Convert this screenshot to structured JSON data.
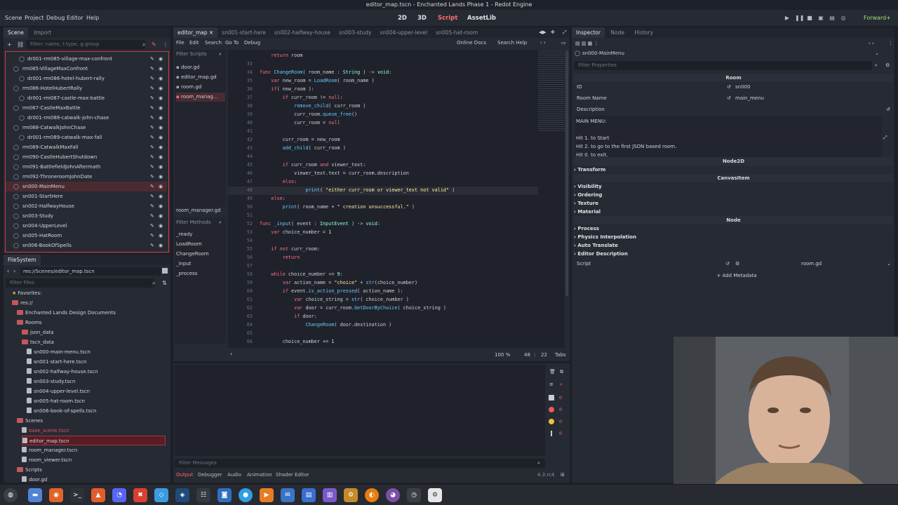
{
  "window_title": "editor_map.tscn - Enchanted Lands Phase 1 - Redot Engine",
  "menu": [
    "Scene",
    "Project",
    "Debug",
    "Editor",
    "Help"
  ],
  "workspaces": [
    "2D",
    "3D",
    "Script",
    "AssetLib"
  ],
  "renderer": "Forward+",
  "scene_dock": {
    "tabs": [
      "Scene",
      "Import"
    ],
    "filter_placeholder": "Filter: name, t:type, g:group",
    "items": [
      {
        "label": "dr001-rm085-village-max-confront",
        "indent": 1
      },
      {
        "label": "rm085-VillageMaxConfront",
        "indent": 0
      },
      {
        "label": "dr001-rm086-hotel-hubert-rally",
        "indent": 1
      },
      {
        "label": "rm086-HotelHubertRally",
        "indent": 0
      },
      {
        "label": "dr001-rm087-castle-max-battle",
        "indent": 1
      },
      {
        "label": "rm087-CastleMaxBattle",
        "indent": 0
      },
      {
        "label": "dr001-rm088-catwalk-john-chase",
        "indent": 1
      },
      {
        "label": "rm088-CatwalkJohnChase",
        "indent": 0
      },
      {
        "label": "dr001-rm089-catwalk-max-fall",
        "indent": 1
      },
      {
        "label": "rm089-CatwalkMaxFall",
        "indent": 0
      },
      {
        "label": "rm090-CastleHubertShutdown",
        "indent": 0
      },
      {
        "label": "rm091-BattlefieldJohnAftermath",
        "indent": 0
      },
      {
        "label": "rm092-ThroneroomJohnDate",
        "indent": 0
      },
      {
        "label": "sn000-MainMenu",
        "indent": 0,
        "selected": true
      },
      {
        "label": "sn001-StartHere",
        "indent": 0
      },
      {
        "label": "sn002-HalfwayHouse",
        "indent": 0
      },
      {
        "label": "sn003-Study",
        "indent": 0
      },
      {
        "label": "sn004-UpperLevel",
        "indent": 0
      },
      {
        "label": "sn005-HatRoom",
        "indent": 0
      },
      {
        "label": "sn006-BookOfSpells",
        "indent": 0
      }
    ]
  },
  "filesystem": {
    "title": "FileSystem",
    "path": "res://Scenes/editor_map.tscn",
    "filter_placeholder": "Filter Files",
    "items": [
      {
        "label": "Favorites:",
        "indent": 1,
        "type": "fav"
      },
      {
        "label": "res://",
        "indent": 1,
        "type": "folder"
      },
      {
        "label": "Enchanted Lands Design Documents",
        "indent": 2,
        "type": "folder"
      },
      {
        "label": "Rooms",
        "indent": 2,
        "type": "folder"
      },
      {
        "label": "json_data",
        "indent": 3,
        "type": "folder"
      },
      {
        "label": "tscn_data",
        "indent": 3,
        "type": "folder"
      },
      {
        "label": "sn000-main-menu.tscn",
        "indent": 4,
        "type": "file"
      },
      {
        "label": "sn001-start-here.tscn",
        "indent": 4,
        "type": "file"
      },
      {
        "label": "sn002-halfway-house.tscn",
        "indent": 4,
        "type": "file"
      },
      {
        "label": "sn003-study.tscn",
        "indent": 4,
        "type": "file"
      },
      {
        "label": "sn004-upper-level.tscn",
        "indent": 4,
        "type": "file"
      },
      {
        "label": "sn005-hat-room.tscn",
        "indent": 4,
        "type": "file"
      },
      {
        "label": "sn006-book-of-spells.tscn",
        "indent": 4,
        "type": "file"
      },
      {
        "label": "Scenes",
        "indent": 2,
        "type": "folder"
      },
      {
        "label": "base_scene.tscn",
        "indent": 3,
        "type": "file",
        "red": true
      },
      {
        "label": "editor_map.tscn",
        "indent": 3,
        "type": "file",
        "selected": true
      },
      {
        "label": "room_manager.tscn",
        "indent": 3,
        "type": "file"
      },
      {
        "label": "room_viewer.tscn",
        "indent": 3,
        "type": "file"
      },
      {
        "label": "Scripts",
        "indent": 2,
        "type": "folder"
      },
      {
        "label": "door.gd",
        "indent": 3,
        "type": "file"
      }
    ]
  },
  "script_tabs": [
    "editor_map",
    "sn001-start-here",
    "sn002-halfway-house",
    "sn003-study",
    "sn004-upper-level",
    "sn005-hat-room"
  ],
  "script_menu": [
    "File",
    "Edit",
    "Search",
    "Go To",
    "Debug"
  ],
  "online_docs": "Online Docs",
  "search_help": "Search Help",
  "filter_scripts": "Filter Scripts",
  "scripts": [
    "door.gd",
    "editor_map.gd",
    "room.gd",
    "room_manag..."
  ],
  "current_script": "room_manager.gd",
  "filter_methods": "Filter Methods",
  "methods": [
    "_ready",
    "LoadRoom",
    "ChangeRoom",
    "_input",
    "_process"
  ],
  "code": [
    {
      "n": "",
      "t": "    return room"
    },
    {
      "n": "33",
      "t": ""
    },
    {
      "n": "34",
      "t": "func ChangeRoom( room_name : String ) -> void:"
    },
    {
      "n": "35",
      "t": "    var new_room = LoadRoom( room_name )"
    },
    {
      "n": "36",
      "t": "    if( new_room ):"
    },
    {
      "n": "37",
      "t": "        if curr_room != null:"
    },
    {
      "n": "38",
      "t": "            remove_child( curr_room )"
    },
    {
      "n": "39",
      "t": "            curr_room.queue_free()"
    },
    {
      "n": "40",
      "t": "            curr_room = null"
    },
    {
      "n": "41",
      "t": ""
    },
    {
      "n": "42",
      "t": "        curr_room = new_room"
    },
    {
      "n": "43",
      "t": "        add_child( curr_room )"
    },
    {
      "n": "44",
      "t": ""
    },
    {
      "n": "45",
      "t": "        if curr_room and viewer_text:"
    },
    {
      "n": "46",
      "t": "            viewer_text.text = curr_room.description"
    },
    {
      "n": "47",
      "t": "        else:"
    },
    {
      "n": "48",
      "t": "                print( \"either curr_room or viewer_text not valid\" )"
    },
    {
      "n": "49",
      "t": "    else:"
    },
    {
      "n": "50",
      "t": "        print( room_name + \" creation unsuccessful.\" )"
    },
    {
      "n": "51",
      "t": ""
    },
    {
      "n": "52",
      "t": "func _input( event : InputEvent ) -> void:"
    },
    {
      "n": "53",
      "t": "    var choice_number = 1"
    },
    {
      "n": "54",
      "t": ""
    },
    {
      "n": "55",
      "t": "    if not curr_room:"
    },
    {
      "n": "56",
      "t": "        return"
    },
    {
      "n": "57",
      "t": ""
    },
    {
      "n": "58",
      "t": "    while choice_number <= 9:"
    },
    {
      "n": "59",
      "t": "        var action_name = \"choice\" + str(choice_number)"
    },
    {
      "n": "60",
      "t": "        if event.is_action_pressed( action_name ):"
    },
    {
      "n": "61",
      "t": "            var choice_string = str( choice_number )"
    },
    {
      "n": "62",
      "t": "            var door = curr_room.GetDoorByChoice( choice_string )"
    },
    {
      "n": "63",
      "t": "            if door:"
    },
    {
      "n": "64",
      "t": "                ChangeRoom( door.destination )"
    },
    {
      "n": "65",
      "t": ""
    },
    {
      "n": "66",
      "t": "        choice_number += 1"
    }
  ],
  "status": {
    "zoom": "100 %",
    "line": "48",
    "col": "22",
    "indent": "Tabs"
  },
  "filter_messages": "Filter Messages",
  "bottom_tabs": [
    "Output",
    "Debugger",
    "Audio",
    "Animation",
    "Shader Editor"
  ],
  "version": "4.3.rc4",
  "debug_counts": [
    "0",
    "0",
    "0",
    "0"
  ],
  "inspector": {
    "tabs": [
      "Inspector",
      "Node",
      "History"
    ],
    "node_path": "sn000-MainMenu",
    "filter_placeholder": "Filter Properties",
    "room_header": "Room",
    "id_label": "ID",
    "id_value": "sn000",
    "room_name_label": "Room Name",
    "room_name_value": "main_menu",
    "description_label": "Description",
    "description_lines": [
      "MAIN MENU:",
      "",
      "Hit 1. to Start",
      "Hit 2. to go to the first JSON based room.",
      "Hit 0. to exit."
    ],
    "node2d_header": "Node2D",
    "transform": "Transform",
    "canvasitem_header": "CanvasItem",
    "canvas_sections": [
      "Visibility",
      "Ordering",
      "Texture",
      "Material"
    ],
    "node_header": "Node",
    "node_sections": [
      "Process",
      "Physics Interpolation",
      "Auto Translate",
      "Editor Description"
    ],
    "script_label": "Script",
    "script_value": "room.gd",
    "add_metadata": "Add Metadata"
  },
  "colors": {
    "accent": "#ff6b75",
    "bg": "#262a33",
    "selection": "#4a2b31"
  }
}
